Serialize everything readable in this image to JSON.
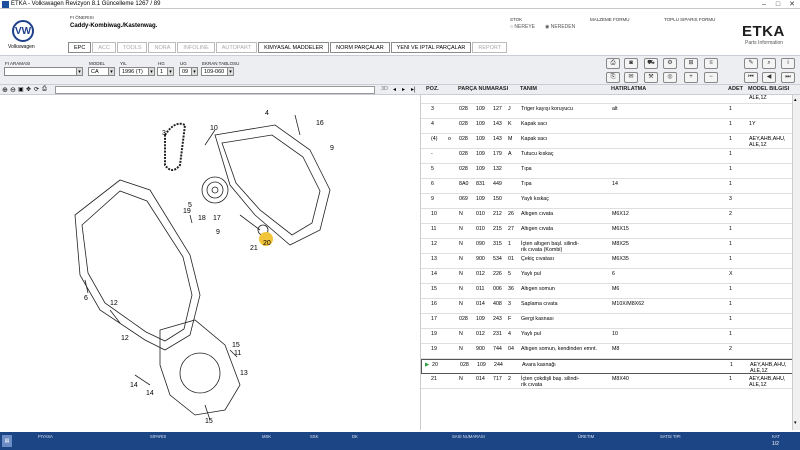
{
  "window": {
    "title": "ETKA - Volkswagen Revizyon 8.1 Güncelleme 1267 / 89",
    "minimize": "–",
    "maximize": "□",
    "close": "✕"
  },
  "brand": {
    "name": "Volkswagen",
    "logo_text": "VW",
    "etka": "ETKA",
    "etka_sub": "Parts Information"
  },
  "header": {
    "fi_label": "FI ÖNERISI",
    "model_title": "Caddy-Kombiwag./Kastenwag.",
    "stok_label": "STOK",
    "stok_opt1": "NEREYE",
    "stok_opt2": "NEREDEN",
    "malzeme_label": "MALZEME FORMU",
    "toplu_label": "TOPLU SIPARIS FORMU"
  },
  "tabs": [
    {
      "label": "EPC",
      "state": "active"
    },
    {
      "label": "ACC",
      "state": "disabled"
    },
    {
      "label": "TOOLS",
      "state": "disabled"
    },
    {
      "label": "NORA",
      "state": "disabled"
    },
    {
      "label": "INFOLINE",
      "state": "disabled"
    },
    {
      "label": "AUTOPART",
      "state": "disabled"
    },
    {
      "label": "KIMYASAL MADDELER",
      "state": "normal"
    },
    {
      "label": "NORM PARÇALAR",
      "state": "normal"
    },
    {
      "label": "YENI VE IPTAL PARÇALAR",
      "state": "normal"
    },
    {
      "label": "REPORT",
      "state": "disabled"
    }
  ],
  "filters": {
    "fi_arama": {
      "label": "FI ARAMASI",
      "value": ""
    },
    "model": {
      "label": "MODEL",
      "value": "CA"
    },
    "yil": {
      "label": "YIL",
      "value": "1996 (T)"
    },
    "hg": {
      "label": "HG",
      "value": "1"
    },
    "ug": {
      "label": "UG",
      "value": "09"
    },
    "ekran": {
      "label": "EKRAN TABLOSU",
      "value": "109-060"
    }
  },
  "imgbar": {
    "zoom_label": "3D"
  },
  "columns": {
    "poz": "POZ.",
    "parca": "PARÇA NUMARASI",
    "tanim": "TANIM",
    "hatirlatma": "HATIRLATMA",
    "adet": "ADET",
    "model": "MODEL BILGISI"
  },
  "top_partial": {
    "model": "ALE,1Z"
  },
  "rows": [
    {
      "poz": "3",
      "p1": "028",
      "p2": "109",
      "p3": "127",
      "p4": "J",
      "tanim": "Triger kayışı koruyucu",
      "hat": "alt",
      "adet": "1",
      "model": ""
    },
    {
      "poz": "4",
      "p1": "028",
      "p2": "109",
      "p3": "143",
      "p4": "K",
      "tanim": "Kapak sacı",
      "hat": "",
      "adet": "1",
      "model": "1Y"
    },
    {
      "poz": "(4)",
      "o": "o",
      "p1": "028",
      "p2": "109",
      "p3": "143",
      "p4": "M",
      "tanim": "Kapak sacı",
      "hat": "",
      "adet": "1",
      "model": "AEY,AHB,AHU,",
      "model2": "ALE,1Z"
    },
    {
      "poz": "-",
      "p1": "028",
      "p2": "109",
      "p3": "179",
      "p4": "A",
      "tanim": "Tutucu kıskaç",
      "hat": "",
      "adet": "1",
      "model": ""
    },
    {
      "poz": "5",
      "p1": "028",
      "p2": "109",
      "p3": "132",
      "p4": "",
      "tanim": "Tıpa",
      "hat": "",
      "adet": "1",
      "model": ""
    },
    {
      "poz": "6",
      "p1": "8A0",
      "p2": "831",
      "p3": "449",
      "p4": "",
      "tanim": "Tıpa",
      "hat": "14",
      "adet": "1",
      "model": ""
    },
    {
      "poz": "9",
      "p1": "069",
      "p2": "109",
      "p3": "150",
      "p4": "",
      "tanim": "Yaylı kıskaç",
      "hat": "",
      "adet": "3",
      "model": ""
    },
    {
      "poz": "10",
      "p1": "N",
      "p2": "010",
      "p3": "212",
      "p4": "26",
      "tanim": "Altıgen cıvata",
      "hat": "M6X12",
      "adet": "2",
      "model": ""
    },
    {
      "poz": "11",
      "p1": "N",
      "p2": "010",
      "p3": "215",
      "p4": "27",
      "tanim": "Altıgen cıvata",
      "hat": "M6X15",
      "adet": "1",
      "model": ""
    },
    {
      "poz": "12",
      "p1": "N",
      "p2": "090",
      "p3": "315",
      "p4": "1",
      "tanim": "İçten altıgen başl. silindi-",
      "tanim2": "rik cıvata (Kombi)",
      "hat": "M8X25",
      "adet": "1",
      "model": ""
    },
    {
      "poz": "13",
      "p1": "N",
      "p2": "900",
      "p3": "534",
      "p4": "01",
      "tanim": "Çekiç cıvatası",
      "hat": "M6X35",
      "adet": "1",
      "model": ""
    },
    {
      "poz": "14",
      "p1": "N",
      "p2": "012",
      "p3": "226",
      "p4": "5",
      "tanim": "Yaylı pul",
      "hat": "6",
      "adet": "X",
      "model": ""
    },
    {
      "poz": "15",
      "p1": "N",
      "p2": "011",
      "p3": "006",
      "p4": "36",
      "tanim": "Altıgen somun",
      "hat": "M6",
      "adet": "1",
      "model": ""
    },
    {
      "poz": "16",
      "p1": "N",
      "p2": "014",
      "p3": "408",
      "p4": "3",
      "tanim": "Saplama cıvata",
      "hat": "M10X/M8X62",
      "adet": "1",
      "model": ""
    },
    {
      "poz": "17",
      "p1": "028",
      "p2": "109",
      "p3": "243",
      "p4": "F",
      "tanim": "Gergi kasnası",
      "hat": "",
      "adet": "1",
      "model": ""
    },
    {
      "poz": "19",
      "p1": "N",
      "p2": "012",
      "p3": "231",
      "p4": "4",
      "tanim": "Yaylı pul",
      "hat": "10",
      "adet": "1",
      "model": ""
    },
    {
      "poz": "19",
      "p1": "N",
      "p2": "900",
      "p3": "744",
      "p4": "04",
      "tanim": "Altıgen somun, kendinden emnt.",
      "hat": "M8",
      "adet": "2",
      "model": ""
    },
    {
      "poz": "20",
      "p1": "028",
      "p2": "109",
      "p3": "244",
      "p4": "",
      "tanim": "Avara kasnağı",
      "hat": "",
      "adet": "1",
      "model": "AEY,AHB,AHU,",
      "model2": "ALE,1Z",
      "selected": true
    },
    {
      "poz": "21",
      "p1": "N",
      "p2": "014",
      "p3": "717",
      "p4": "2",
      "tanim": "İçten çokdişli baş. silindi-",
      "tanim2": "rik cıvata",
      "hat": "M8X40",
      "adet": "1",
      "model": "AEY,AHB,AHU,",
      "model2": "ALE,1Z"
    }
  ],
  "diagram_labels": [
    "4",
    "10",
    "16",
    "3",
    "9",
    "17",
    "18",
    "19",
    "5",
    "21",
    "20",
    "6",
    "12",
    "14",
    "15",
    "11",
    "13",
    "15",
    "12",
    "14",
    "9"
  ],
  "status": {
    "piyasa": "PIYASA",
    "siparis": "SIPARIS",
    "msk": "MSK",
    "ssk": "SSK",
    "dk": "DK",
    "sasi": "SASI NUMARASI",
    "uretim": "ÜRETIM",
    "satis": "SATIS TIPI",
    "kat_label": "KAT",
    "kat_value": "1/2"
  },
  "colors": {
    "accent": "#1c4585",
    "highlight": "#f3c53a"
  }
}
